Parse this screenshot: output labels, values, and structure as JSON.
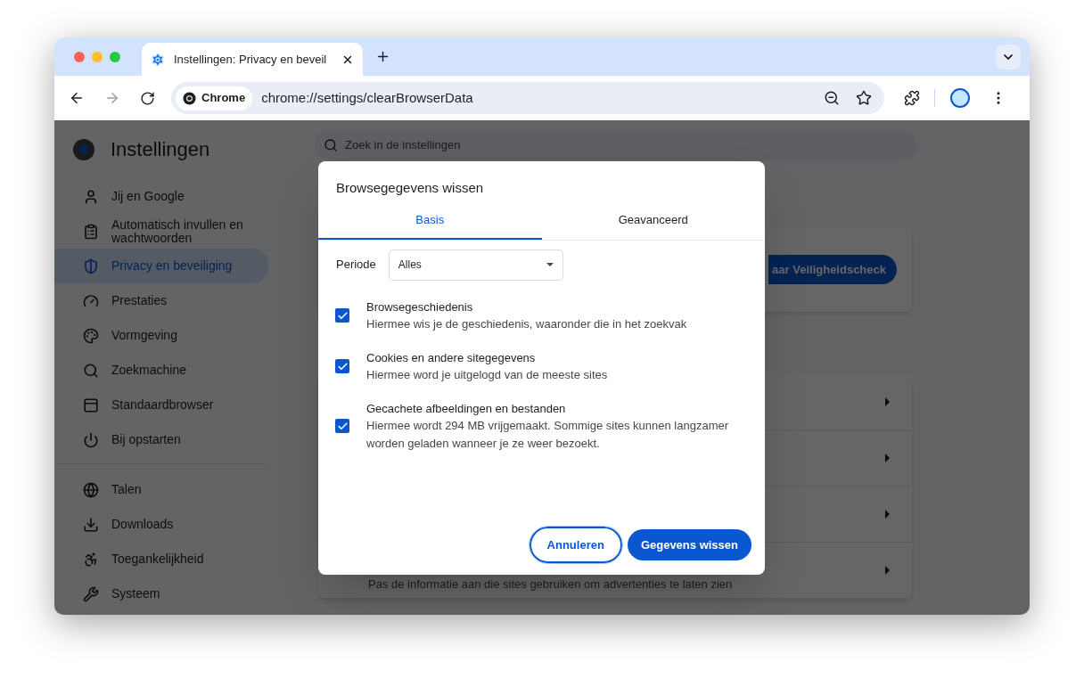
{
  "browser_tabs": [
    {
      "title": "Instellingen: Privacy en beveil",
      "selected": true
    }
  ],
  "toolbar": {
    "chip": "Chrome",
    "url": "chrome://settings/clearBrowserData"
  },
  "sidebar": {
    "title": "Instellingen",
    "groups": [
      [
        {
          "label": "Jij en Google",
          "selected": false
        },
        {
          "label": "Automatisch invullen en wachtwoorden",
          "selected": false
        },
        {
          "label": "Privacy en beveiliging",
          "selected": true
        },
        {
          "label": "Prestaties",
          "selected": false
        },
        {
          "label": "Vormgeving",
          "selected": false
        },
        {
          "label": "Zoekmachine",
          "selected": false
        },
        {
          "label": "Standaardbrowser",
          "selected": false
        },
        {
          "label": "Bij opstarten",
          "selected": false
        }
      ],
      [
        {
          "label": "Talen",
          "selected": false
        },
        {
          "label": "Downloads",
          "selected": false
        },
        {
          "label": "Toegankelijkheid",
          "selected": false
        },
        {
          "label": "Systeem",
          "selected": false
        }
      ]
    ]
  },
  "search": {
    "placeholder": "Zoek in de instellingen"
  },
  "safety_check": {
    "button": "aar Veiligheidscheck"
  },
  "settings_rows": [
    {},
    {},
    {},
    {
      "description": "Pas de informatie aan die sites gebruiken om advertenties te laten zien"
    }
  ],
  "dialog": {
    "title": "Browsegegevens wissen",
    "tabs": [
      {
        "label": "Basis",
        "selected": true
      },
      {
        "label": "Geavanceerd",
        "selected": false
      }
    ],
    "period": {
      "label": "Periode",
      "value": "Alles"
    },
    "options": [
      {
        "title": "Browsegeschiedenis",
        "description": "Hiermee wis je de geschiedenis, waaronder die in het zoekvak",
        "checked": true
      },
      {
        "title": "Cookies en andere sitegegevens",
        "description": "Hiermee word je uitgelogd van de meeste sites",
        "checked": true
      },
      {
        "title": "Gecachete afbeeldingen en bestanden",
        "description": "Hiermee wordt 294 MB vrijgemaakt. Sommige sites kunnen langzamer worden geladen wanneer je ze weer bezoekt.",
        "checked": true
      }
    ],
    "buttons": {
      "cancel": "Annuleren",
      "confirm": "Gegevens wissen"
    }
  }
}
